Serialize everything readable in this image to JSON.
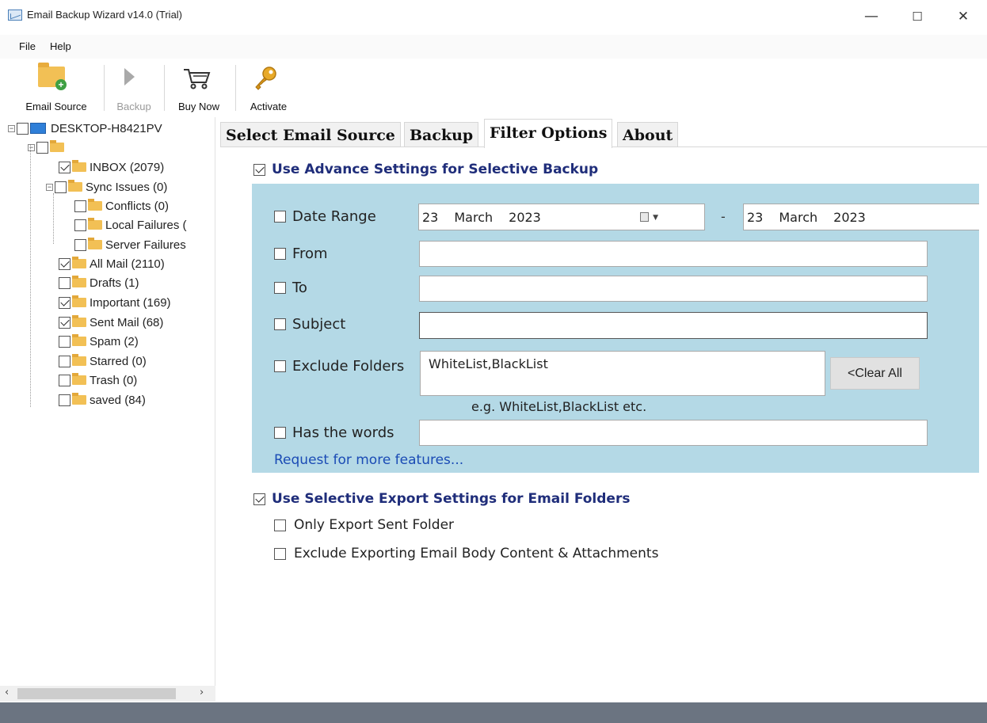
{
  "window": {
    "title": "Email Backup Wizard v14.0 (Trial)",
    "minimize": "—",
    "maximize": "☐",
    "close": "✕"
  },
  "menu": [
    "File",
    "Help"
  ],
  "toolbar": {
    "email_source": "Email Source",
    "backup": "Backup",
    "buy_now": "Buy Now",
    "activate": "Activate"
  },
  "tree": {
    "root": "DESKTOP-H8421PV",
    "items": [
      {
        "label": "INBOX (2079)",
        "checked": true
      },
      {
        "label": "Sync Issues (0)",
        "checked": false
      },
      {
        "label": "Conflicts (0)",
        "checked": false
      },
      {
        "label": "Local Failures (",
        "checked": false
      },
      {
        "label": "Server Failures",
        "checked": false
      },
      {
        "label": "All Mail (2110)",
        "checked": true
      },
      {
        "label": "Drafts (1)",
        "checked": false
      },
      {
        "label": "Important (169)",
        "checked": true
      },
      {
        "label": "Sent Mail (68)",
        "checked": true
      },
      {
        "label": "Spam (2)",
        "checked": false
      },
      {
        "label": "Starred (0)",
        "checked": false
      },
      {
        "label": "Trash (0)",
        "checked": false
      },
      {
        "label": "saved (84)",
        "checked": false
      }
    ]
  },
  "tabs": [
    "Select Email Source",
    "Backup",
    "Filter Options",
    "About"
  ],
  "active_tab": "Filter Options",
  "filters": {
    "advance_heading": "Use Advance Settings for Selective Backup",
    "advance_checked": true,
    "date_range_label": "Date Range",
    "date_from": {
      "day": "23",
      "month": "March",
      "year": "2023"
    },
    "date_to": {
      "day": "23",
      "month": "March",
      "year": "2023"
    },
    "date_separator": "-",
    "from_label": "From",
    "to_label": "To",
    "subject_label": "Subject",
    "exclude_folders_label": "Exclude Folders",
    "exclude_folders_value": "WhiteList,BlackList",
    "clear_all": "<Clear All",
    "hint": "e.g. WhiteList,BlackList etc.",
    "has_words_label": "Has the words",
    "request_link": "Request for more features..."
  },
  "export": {
    "heading": "Use Selective Export Settings for Email Folders",
    "heading_checked": true,
    "only_sent": "Only Export Sent Folder",
    "exclude_body": "Exclude Exporting Email Body Content & Attachments"
  },
  "colors": {
    "panel_bg": "#b4d9e6",
    "heading_text": "#1f2d7a",
    "link": "#1a4bb5",
    "statusbar": "#6b7481"
  }
}
